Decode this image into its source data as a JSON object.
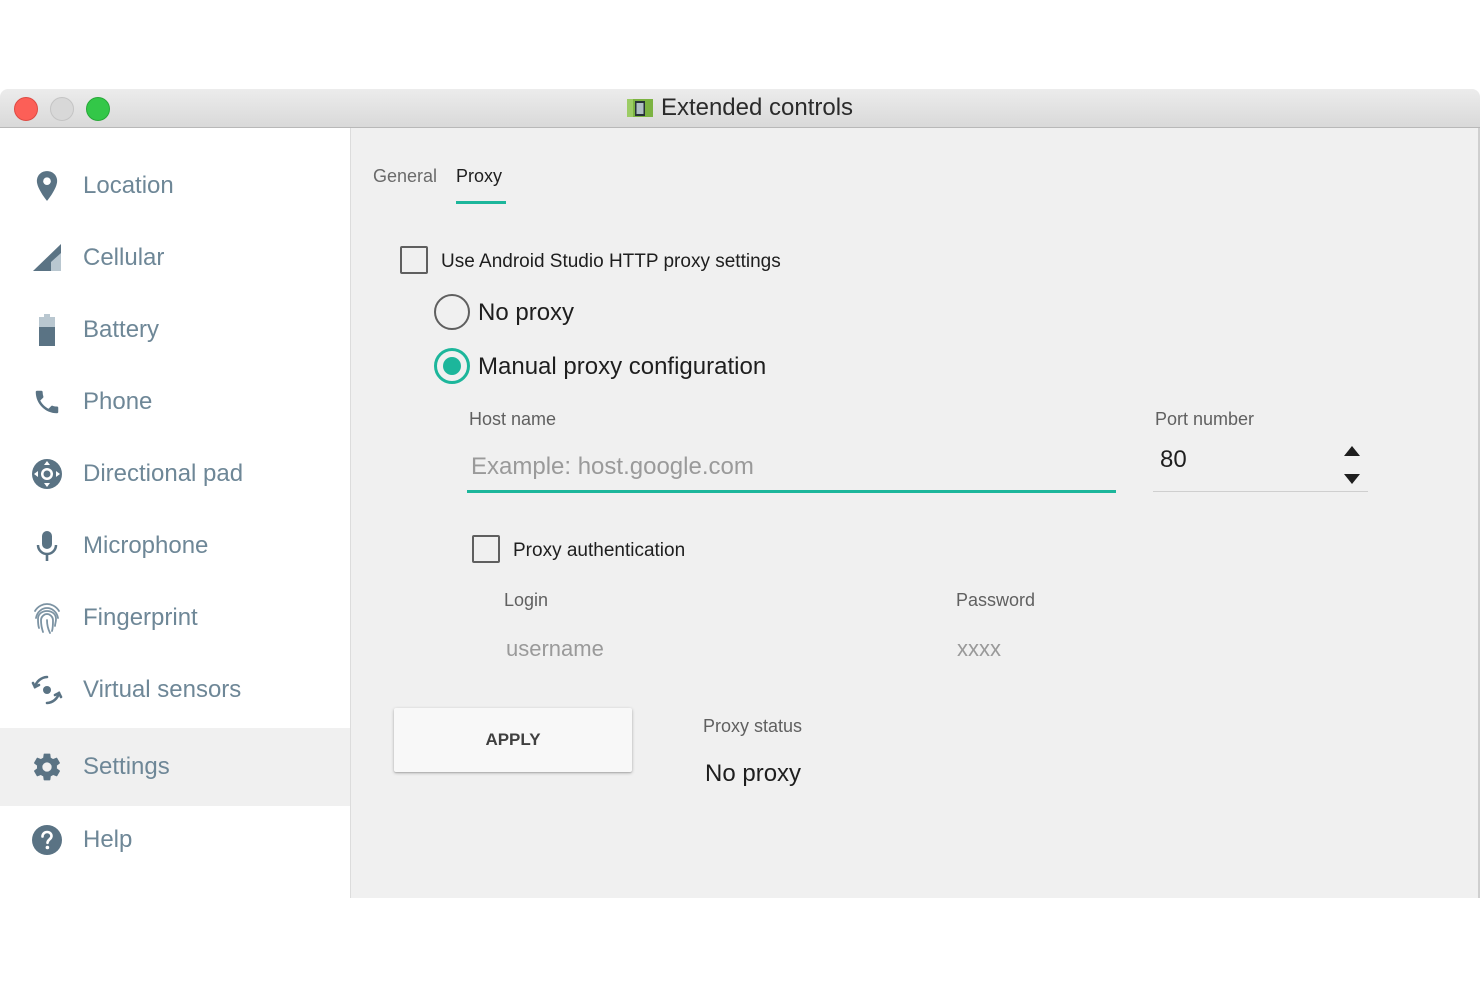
{
  "window": {
    "title": "Extended controls"
  },
  "sidebar": {
    "items": [
      {
        "label": "Location",
        "icon": "location-pin-icon"
      },
      {
        "label": "Cellular",
        "icon": "cellular-signal-icon"
      },
      {
        "label": "Battery",
        "icon": "battery-icon"
      },
      {
        "label": "Phone",
        "icon": "phone-icon"
      },
      {
        "label": "Directional pad",
        "icon": "directional-pad-icon"
      },
      {
        "label": "Microphone",
        "icon": "microphone-icon"
      },
      {
        "label": "Fingerprint",
        "icon": "fingerprint-icon"
      },
      {
        "label": "Virtual sensors",
        "icon": "virtual-sensors-icon"
      },
      {
        "label": "Settings",
        "icon": "gear-icon",
        "selected": true
      },
      {
        "label": "Help",
        "icon": "help-icon"
      }
    ]
  },
  "tabs": [
    {
      "label": "General",
      "active": false
    },
    {
      "label": "Proxy",
      "active": true
    }
  ],
  "proxy": {
    "use_studio_settings_label": "Use Android Studio HTTP proxy settings",
    "use_studio_settings_checked": false,
    "no_proxy_label": "No proxy",
    "manual_label": "Manual proxy configuration",
    "selected_mode": "manual",
    "host_label": "Host name",
    "host_placeholder": "Example: host.google.com",
    "port_label": "Port number",
    "port_value": "80",
    "auth_label": "Proxy authentication",
    "auth_checked": false,
    "login_label": "Login",
    "login_placeholder": "username",
    "password_label": "Password",
    "password_placeholder": "xxxx",
    "apply_label": "APPLY",
    "status_label": "Proxy status",
    "status_value": "No proxy"
  },
  "colors": {
    "accent": "#1cb69b",
    "sidebar_text": "#6e8797",
    "icon": "#5a7384",
    "content_bg": "#f0f0f0"
  }
}
